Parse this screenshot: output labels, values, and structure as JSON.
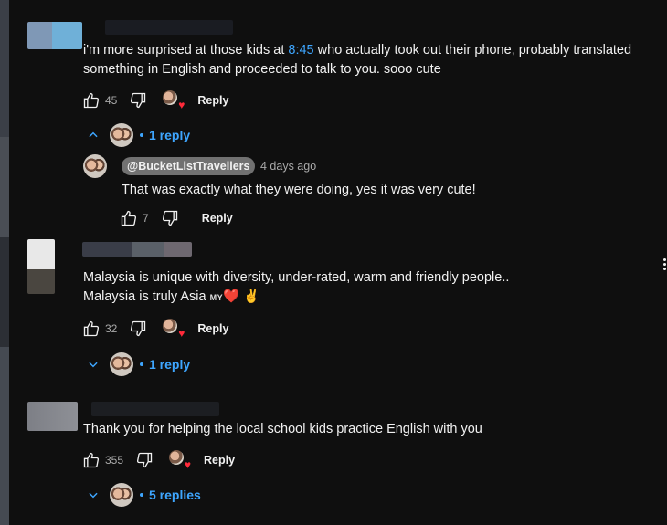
{
  "comments": [
    {
      "text_before": "i'm more surprised at those kids at ",
      "timestamp": "8:45",
      "text_after": " who actually took out their phone, probably translated something in English and proceeded to talk to you. sooo cute",
      "likes": "45",
      "reply_label": "Reply",
      "replies_toggle": "1 reply",
      "replies_expanded": true,
      "reply": {
        "handle": "@BucketListTravellers",
        "time": "4 days ago",
        "text": "That was exactly what they were doing, yes it was very cute!",
        "likes": "7",
        "reply_label": "Reply"
      }
    },
    {
      "line1": "Malaysia is unique with diversity,  under-rated, warm and friendly people..",
      "line2": "Malaysia is truly Asia ",
      "flag": "MY",
      "emoji": "❤️ ✌",
      "likes": "32",
      "reply_label": "Reply",
      "replies_toggle": "1 reply",
      "replies_expanded": false
    },
    {
      "text": "Thank you for helping the local school kids practice English with you",
      "likes": "355",
      "reply_label": "Reply",
      "replies_toggle": "5 replies",
      "replies_expanded": false
    }
  ],
  "icons": {
    "like": "thumbs-up-icon",
    "dislike": "thumbs-down-icon",
    "creator_heart": "creator-heart-icon",
    "expand": "chevron-down-icon",
    "collapse": "chevron-up-icon",
    "menu": "more-vert-icon"
  },
  "colors": {
    "background": "#0f0f0f",
    "link": "#3ea6ff",
    "heart": "#ff2a3a",
    "secondary_text": "#aaaaaa"
  }
}
